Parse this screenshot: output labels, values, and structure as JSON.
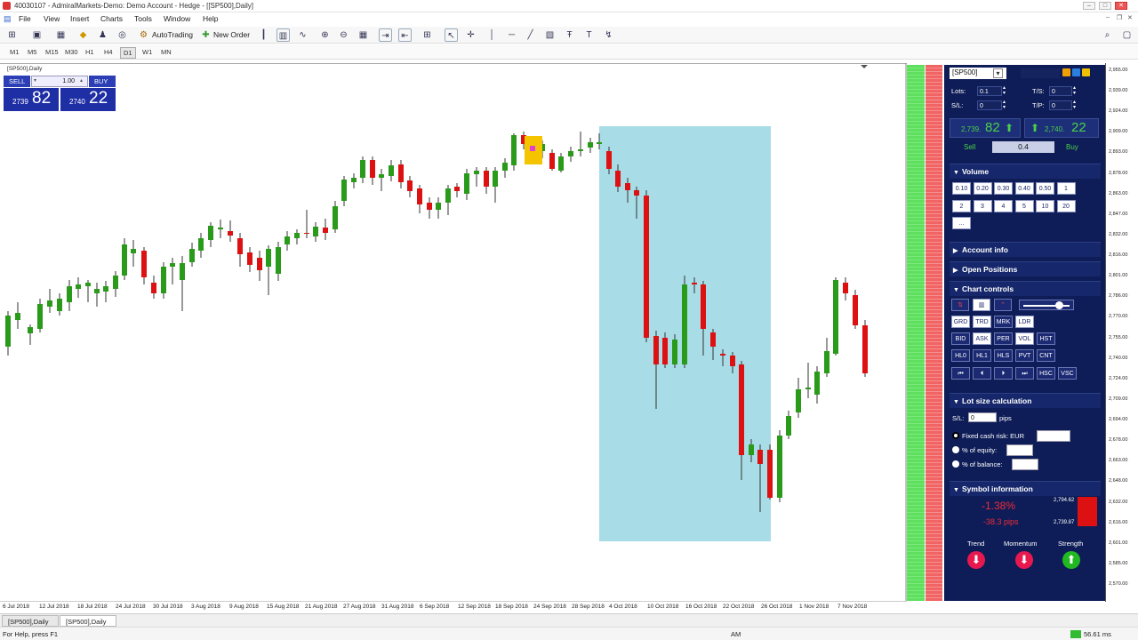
{
  "window": {
    "title": "40030107 - AdmiralMarkets-Demo: Demo Account - Hedge - [[SP500],Daily]"
  },
  "menu": [
    "File",
    "View",
    "Insert",
    "Charts",
    "Tools",
    "Window",
    "Help"
  ],
  "toolbar": {
    "autotrading_label": "AutoTrading",
    "neworder_label": "New Order"
  },
  "timeframes": [
    "M1",
    "M5",
    "M15",
    "M30",
    "H1",
    "H4",
    "D1",
    "W1",
    "MN"
  ],
  "timeframe_active": "D1",
  "chart": {
    "label": "[SP500],Daily",
    "one_click": {
      "sell_label": "SELL",
      "buy_label": "BUY",
      "lot_value": "1.00",
      "sell_big": "2739",
      "sell_pips": "82",
      "buy_big": "2740",
      "buy_pips": "22"
    },
    "x_labels": [
      "6 Jul 2018",
      "12 Jul 2018",
      "18 Jul 2018",
      "24 Jul 2018",
      "30 Jul 2018",
      "3 Aug 2018",
      "9 Aug 2018",
      "15 Aug 2018",
      "21 Aug 2018",
      "27 Aug 2018",
      "31 Aug 2018",
      "6 Sep 2018",
      "12 Sep 2018",
      "18 Sep 2018",
      "24 Sep 2018",
      "28 Sep 2018",
      "4 Oct 2018",
      "10 Oct 2018",
      "16 Oct 2018",
      "22 Oct 2018",
      "26 Oct 2018",
      "1 Nov 2018",
      "7 Nov 2018"
    ],
    "y_labels": [
      "2,955.00",
      "2,939.00",
      "2,924.00",
      "2,909.00",
      "2,893.00",
      "2,878.00",
      "2,863.00",
      "2,847.00",
      "2,832.00",
      "2,816.00",
      "2,801.00",
      "2,786.00",
      "2,770.00",
      "2,755.00",
      "2,740.00",
      "2,724.00",
      "2,709.00",
      "2,694.00",
      "2,678.00",
      "2,663.00",
      "2,648.00",
      "2,632.00",
      "2,616.00",
      "2,601.00",
      "2,585.00",
      "2,570.00"
    ],
    "colors": {
      "bull": "#2a9a1a",
      "bear": "#dd1111",
      "highlight": "#a8dce6",
      "marker": "#f4c400"
    }
  },
  "panel": {
    "symbol": "[SP500]",
    "lots_label": "Lots:",
    "lots_value": "0.1",
    "ts_label": "T/S:",
    "ts_value": "0",
    "sl_label": "S/L:",
    "sl_value": "0",
    "tp_label": "T/P:",
    "tp_value": "0",
    "sell_price_small": "2,739.",
    "sell_price_big": "82",
    "buy_price_small": "2,740.",
    "buy_price_big": "22",
    "sell_label": "Sell",
    "buy_label": "Buy",
    "spread": "0.4",
    "volume_title": "Volume",
    "volume_buttons": [
      "0.10",
      "0.20",
      "0.30",
      "0.40",
      "0.50",
      "1",
      "2",
      "3",
      "4",
      "5",
      "10",
      "20",
      "..."
    ],
    "account_info_title": "Account info",
    "open_positions_title": "Open Positions",
    "chart_controls_title": "Chart controls",
    "cc_row2": [
      "GRD",
      "TRD",
      "MRK",
      "LDR"
    ],
    "cc_row3": [
      "BID",
      "ASK",
      "PER",
      "VOL",
      "HST"
    ],
    "cc_row4": [
      "HL0",
      "HL1",
      "HLS",
      "PVT",
      "CNT"
    ],
    "cc_row5_last": [
      "HSC",
      "VSC"
    ],
    "lot_size_title": "Lot size calculation",
    "lsc_sl_label": "S/L:",
    "lsc_sl_value": "0",
    "lsc_pips": "pips",
    "lsc_fixed": "Fixed cash risk: EUR",
    "lsc_equity": "% of equity:",
    "lsc_balance": "% of balance:",
    "symbol_info_title": "Symbol information",
    "si_change_pct": "-1.38%",
    "si_change_pips": "-38.3 pips",
    "si_high": "2,794.62",
    "si_low": "2,739.87",
    "trend_label": "Trend",
    "momentum_label": "Momentum",
    "strength_label": "Strength"
  },
  "tabs": [
    "[SP500],Daily",
    "[SP500],Daily"
  ],
  "status": {
    "help": "For Help, press F1",
    "ampm": "AM",
    "ping": "56.61 ms"
  }
}
